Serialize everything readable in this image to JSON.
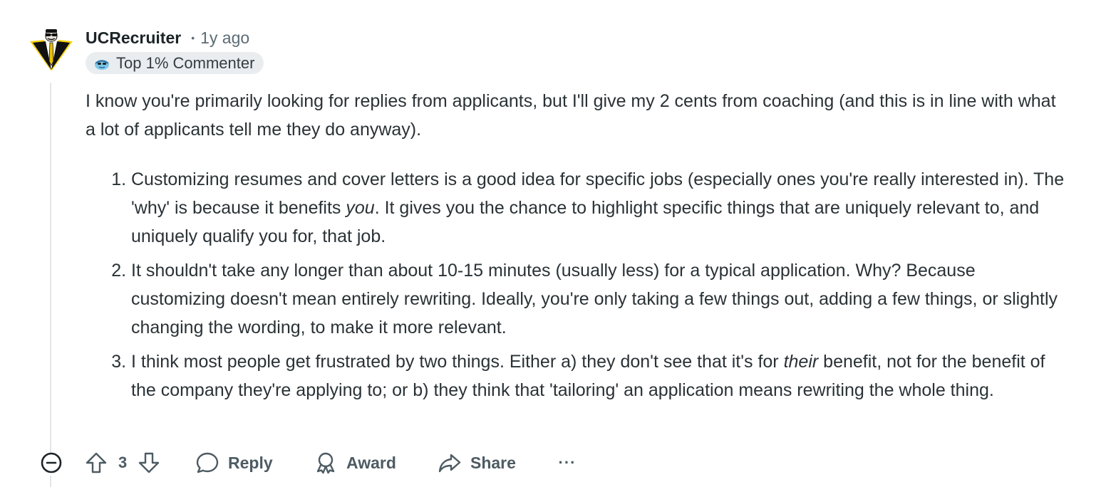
{
  "comment": {
    "author": "UCRecruiter",
    "separator": "•",
    "time_ago": "1y ago",
    "flair": "Top 1% Commenter",
    "avatar_icon": "avatar-icon",
    "intro": "I know you're primarily looking for replies from applicants, but I'll give my 2 cents from coaching (and this is in line with what a lot of applicants tell me they do anyway).",
    "points": [
      {
        "before": "Customizing resumes and cover letters is a good idea for specific jobs (especially ones you're really interested in). The 'why' is because it benefits ",
        "emph": "you",
        "after": ". It gives you the chance to highlight specific things that are uniquely relevant to, and uniquely qualify you for, that job."
      },
      {
        "text": "It shouldn't take any longer than about 10-15 minutes (usually less) for a typical application. Why? Because customizing doesn't mean entirely rewriting. Ideally, you're only taking a few things out, adding a few things, or slightly changing the wording, to make it more relevant."
      },
      {
        "before": "I think most people get frustrated by two things. Either a) they don't see that it's for ",
        "emph": "their",
        "after": " benefit, not for the benefit of the company they're applying to; or b) they think that 'tailoring' an application means rewriting the whole thing."
      }
    ]
  },
  "actions": {
    "vote_count": "3",
    "reply_label": "Reply",
    "award_label": "Award",
    "share_label": "Share",
    "more_label": "···"
  },
  "colors": {
    "text": "#2a3236",
    "muted": "#5c6c74",
    "action": "#4d5b63",
    "flair_bg": "#eaedef",
    "thread_line": "#e3e6e8"
  }
}
